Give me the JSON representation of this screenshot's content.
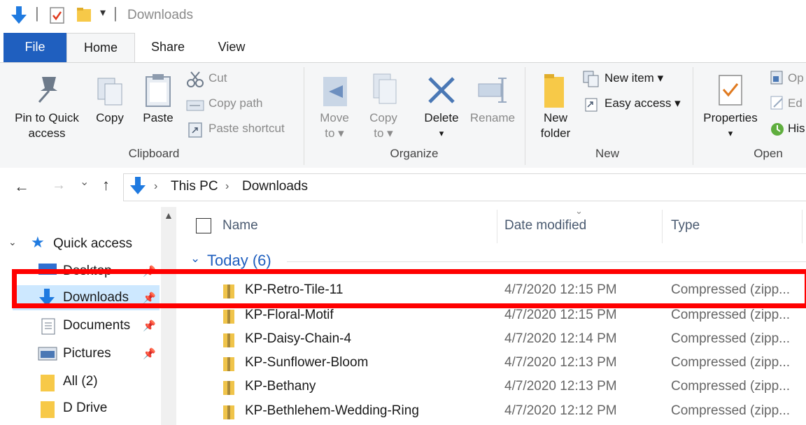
{
  "title_bar": {
    "title": "Downloads",
    "dropdown_glyph": "▾"
  },
  "ribbon_tabs": [
    "File",
    "Home",
    "Share",
    "View"
  ],
  "ribbon": {
    "clipboard": {
      "pin_label_1": "Pin to Quick",
      "pin_label_2": "access",
      "copy_label": "Copy",
      "paste_label": "Paste",
      "cut_label": "Cut",
      "copy_path_label": "Copy path",
      "paste_shortcut_label": "Paste shortcut",
      "group_label": "Clipboard"
    },
    "organize": {
      "move_to_1": "Move",
      "move_to_2": "to ▾",
      "copy_to_1": "Copy",
      "copy_to_2": "to ▾",
      "delete_label": "Delete",
      "delete_arrow": "▾",
      "rename_label": "Rename",
      "group_label": "Organize"
    },
    "new": {
      "new_folder_1": "New",
      "new_folder_2": "folder",
      "new_item_label": "New item ▾",
      "easy_access_label": "Easy access ▾",
      "group_label": "New"
    },
    "open": {
      "properties_label": "Properties",
      "properties_arrow": "▾",
      "open_label": "Op",
      "edit_label": "Ed",
      "history_label": "His",
      "group_label": "Open"
    }
  },
  "address": {
    "back": "←",
    "forward": "→",
    "recent": "⌄",
    "up": "↑",
    "crumbs": [
      "This PC",
      "Downloads"
    ],
    "sep": "›"
  },
  "nav": {
    "quick_access": "Quick access",
    "items": [
      {
        "label": "Desktop",
        "pinned": true
      },
      {
        "label": "Downloads",
        "pinned": true
      },
      {
        "label": "Documents",
        "pinned": true
      },
      {
        "label": "Pictures",
        "pinned": true
      },
      {
        "label": "All (2)",
        "pinned": false
      },
      {
        "label": "D Drive",
        "pinned": false
      }
    ],
    "pin_glyph": "📌"
  },
  "columns": {
    "name": "Name",
    "date": "Date modified",
    "type": "Type"
  },
  "group": {
    "label": "Today (6)",
    "chevron": "⌄"
  },
  "files": [
    {
      "name": "KP-Retro-Tile-11",
      "date": "4/7/2020 12:15 PM",
      "type": "Compressed (zipp..."
    },
    {
      "name": "KP-Floral-Motif",
      "date": "4/7/2020 12:15 PM",
      "type": "Compressed (zipp..."
    },
    {
      "name": "KP-Daisy-Chain-4",
      "date": "4/7/2020 12:14 PM",
      "type": "Compressed (zipp..."
    },
    {
      "name": "KP-Sunflower-Bloom",
      "date": "4/7/2020 12:13 PM",
      "type": "Compressed (zipp..."
    },
    {
      "name": "KP-Bethany",
      "date": "4/7/2020 12:13 PM",
      "type": "Compressed (zipp..."
    },
    {
      "name": "KP-Bethlehem-Wedding-Ring",
      "date": "4/7/2020 12:12 PM",
      "type": "Compressed (zipp..."
    }
  ],
  "colors": {
    "accent": "#1f5fbf",
    "selection": "#cde8ff",
    "highlight": "#ff0000"
  }
}
